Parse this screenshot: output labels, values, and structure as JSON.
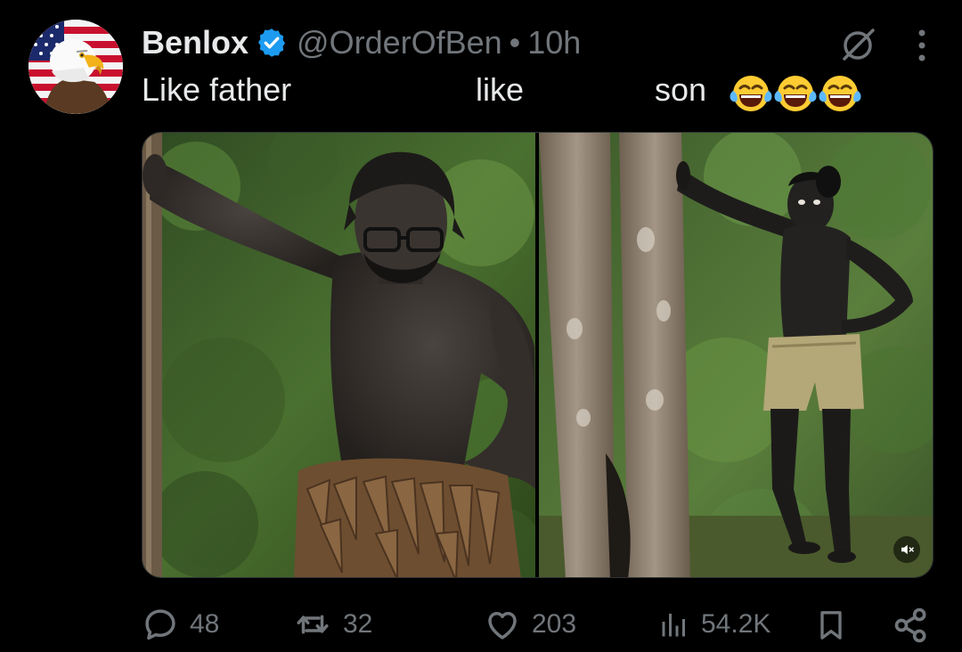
{
  "post": {
    "author": {
      "display_name": "Benlox",
      "handle": "@OrderOfBen",
      "separator": "•",
      "time": "10h",
      "verified": true,
      "avatar_icon": "bald-eagle-flag-avatar"
    },
    "text": {
      "part1": "Like father",
      "part2": "like",
      "part3": "son",
      "emojis": [
        "face-with-tears-of-joy",
        "face-with-tears-of-joy",
        "face-with-tears-of-joy"
      ]
    },
    "media": {
      "count": 2,
      "images": [
        "man-leaning-on-tree-leaf-skirt",
        "boy-leaning-on-tree-khaki-shorts"
      ],
      "muted_indicator_icon": "volume-muted-icon"
    },
    "actions": {
      "replies": "48",
      "reposts": "32",
      "likes": "203",
      "views": "54.2K"
    }
  },
  "colors": {
    "background": "#000000",
    "primary_text": "#e7e9ea",
    "secondary_text": "#71767b",
    "verified_blue": "#1d9bf0"
  }
}
